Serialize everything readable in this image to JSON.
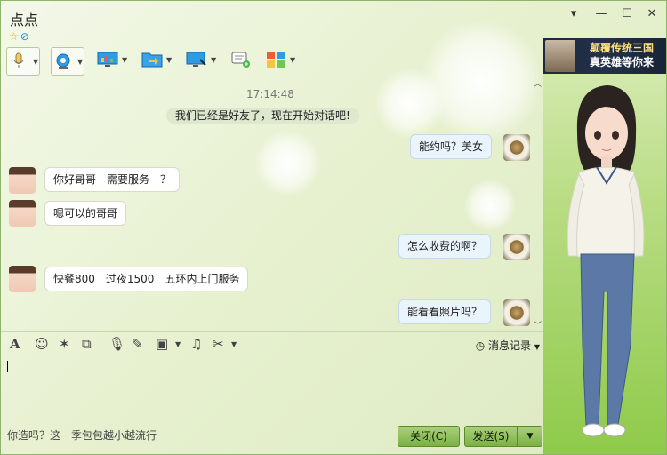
{
  "window": {
    "title": "点点",
    "controls": {
      "menu": "▾",
      "minimize": "—",
      "maximize": "☐",
      "close": "✕"
    }
  },
  "toolbar": {
    "items": [
      {
        "icon": "microphone-icon"
      },
      {
        "icon": "webcam-icon"
      },
      {
        "icon": "screen-share-icon"
      },
      {
        "icon": "file-transfer-icon"
      },
      {
        "icon": "remote-desktop-icon"
      },
      {
        "icon": "message-add-icon"
      },
      {
        "icon": "apps-icon"
      }
    ]
  },
  "chat": {
    "timestamp": "17:14:48",
    "system_message": "我们已经是好友了，现在开始对话吧!",
    "messages": [
      {
        "side": "out",
        "text": "能约吗？美女"
      },
      {
        "side": "in",
        "text": "你好哥哥　需要服务　？"
      },
      {
        "side": "in",
        "text": "嗯可以的哥哥"
      },
      {
        "side": "out",
        "text": "怎么收费的啊？"
      },
      {
        "side": "in",
        "text": "快餐800　过夜1500　五环内上门服务"
      },
      {
        "side": "out",
        "text": "能看看照片吗？"
      }
    ]
  },
  "input_toolbar": {
    "icons": [
      "font-icon",
      "emoji-icon",
      "nudge-icon",
      "screenshot-icon",
      "voice-message-icon",
      "edit-icon",
      "image-icon",
      "music-icon",
      "scissors-icon"
    ],
    "history_label": "消息记录"
  },
  "input": {
    "value": ""
  },
  "footer": {
    "ad_text": "你造吗？这一季包包越小越流行",
    "close_label": "关闭(C)",
    "send_label": "发送(S)"
  },
  "banner": {
    "line1": "颠覆传统三国",
    "line2": "真英雄等你来",
    "side_text": "三国"
  },
  "colors": {
    "accent": "#7cb145",
    "bubble_out": "#eaf4fc",
    "bubble_in": "#ffffff"
  }
}
